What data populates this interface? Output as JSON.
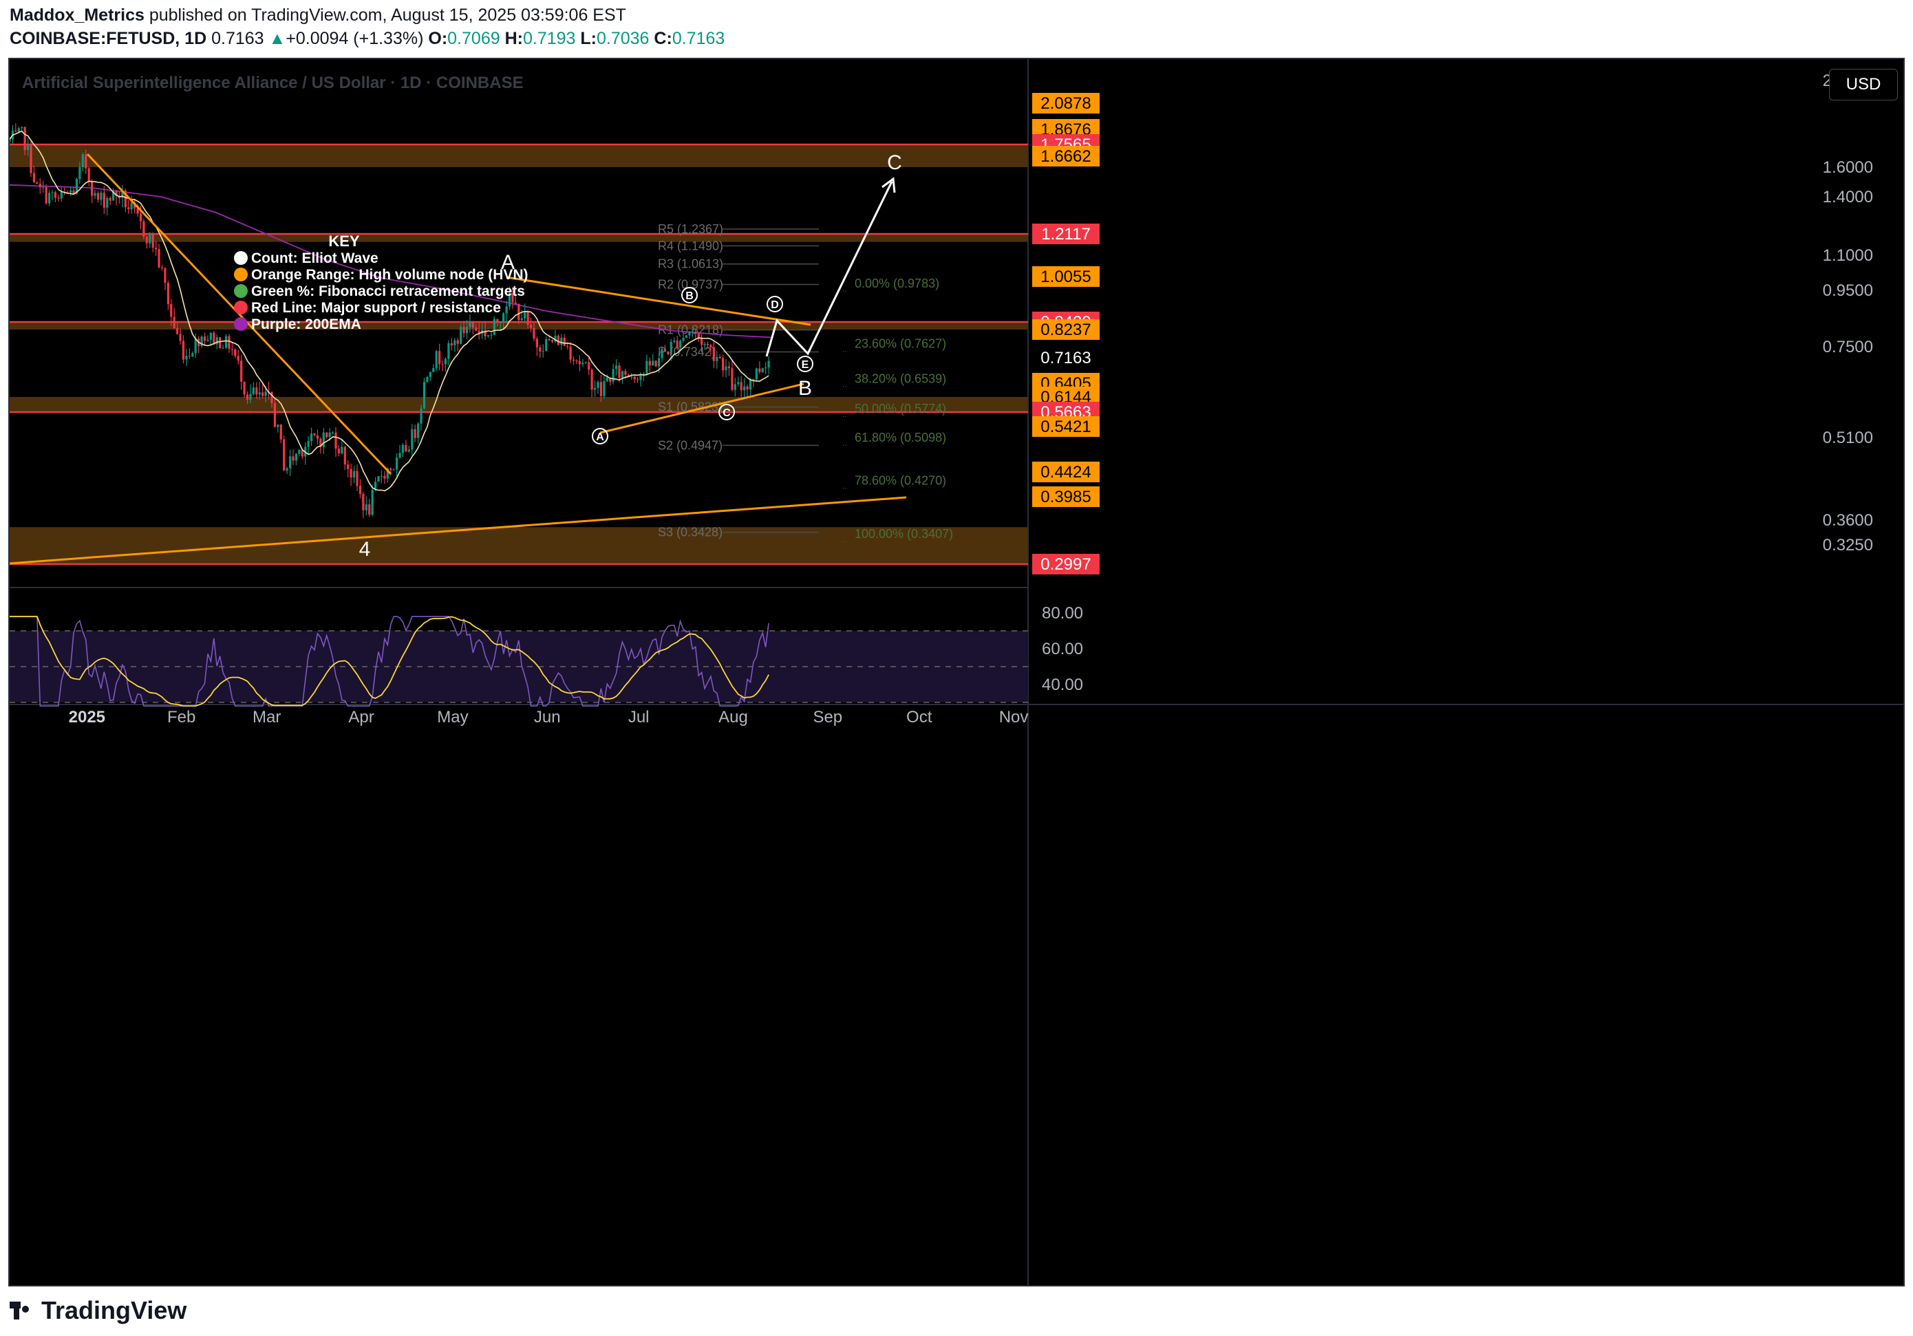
{
  "header": {
    "publisher": "Maddox_Metrics",
    "published_text": "published on TradingView.com, August 15, 2025 03:59:06 EST",
    "symbol": "COINBASE:FETUSD, 1D",
    "last": "0.7163",
    "change": "+0.0094 (+1.33%)",
    "open_label": "O:",
    "open": "0.7069",
    "high_label": "H:",
    "high": "0.7193",
    "low_label": "L:",
    "low": "0.7036",
    "close_label": "C:",
    "close": "0.7163"
  },
  "chart": {
    "watermark": "Artificial Superintelligence Alliance / US Dollar · 1D · COINBASE",
    "currency_button": "USD"
  },
  "legend": {
    "title": "KEY",
    "items": [
      {
        "color": "#ffffff",
        "text": "Count: Elliot Wave"
      },
      {
        "color": "#ff9800",
        "text": "Orange Range: High volume node (HVN)"
      },
      {
        "color": "#4caf50",
        "text": "Green %: Fibonacci retracement targets"
      },
      {
        "color": "#f23645",
        "text": "Red Line: Major support / resistance"
      },
      {
        "color": "#9c27b0",
        "text": "Purple: 200EMA"
      }
    ]
  },
  "price_axis": {
    "ticks": [
      {
        "price": 2.3,
        "label": "2.3000"
      },
      {
        "price": 1.6,
        "label": "1.6000"
      },
      {
        "price": 1.4,
        "label": "1.4000"
      },
      {
        "price": 1.1,
        "label": "1.1000"
      },
      {
        "price": 0.95,
        "label": "0.9500"
      },
      {
        "price": 0.75,
        "label": "0.7500"
      },
      {
        "price": 0.51,
        "label": "0.5100"
      },
      {
        "price": 0.36,
        "label": "0.3600"
      },
      {
        "price": 0.325,
        "label": "0.3250"
      }
    ],
    "badges": [
      {
        "price": 2.0878,
        "label": "2.0878",
        "color": "#ff9800",
        "text_color": "#000000"
      },
      {
        "price": 1.8676,
        "label": "1.8676",
        "color": "#ff9800",
        "text_color": "#000000"
      },
      {
        "price": 1.7565,
        "label": "1.7565",
        "color": "#f23645",
        "text_color": "#ffffff"
      },
      {
        "price": 1.6662,
        "label": "1.6662",
        "color": "#ff9800",
        "text_color": "#000000"
      },
      {
        "price": 1.2117,
        "label": "1.2117",
        "color": "#f23645",
        "text_color": "#ffffff"
      },
      {
        "price": 1.0055,
        "label": "1.0055",
        "color": "#ff9800",
        "text_color": "#000000"
      },
      {
        "price": 0.8429,
        "label": "0.8429",
        "color": "#f23645",
        "text_color": "#ffffff"
      },
      {
        "price": 0.8237,
        "label": "0.8237",
        "color": "#ff9800",
        "text_color": "#000000"
      },
      {
        "price": 0.7163,
        "label": "0.7163",
        "color": "#000000",
        "text_color": "#ffffff"
      },
      {
        "price": 0.6405,
        "label": "0.6405",
        "color": "#ff9800",
        "text_color": "#000000"
      },
      {
        "price": 0.6144,
        "label": "0.6144",
        "color": "#ff9800",
        "text_color": "#000000"
      },
      {
        "price": 0.5663,
        "label": "0.5663",
        "color": "#f23645",
        "text_color": "#ffffff"
      },
      {
        "price": 0.5421,
        "label": "0.5421",
        "color": "#ff9800",
        "text_color": "#000000"
      },
      {
        "price": 0.4424,
        "label": "0.4424",
        "color": "#ff9800",
        "text_color": "#000000"
      },
      {
        "price": 0.3985,
        "label": "0.3985",
        "color": "#ff9800",
        "text_color": "#000000"
      },
      {
        "price": 0.2997,
        "label": "0.2997",
        "color": "#f23645",
        "text_color": "#ffffff"
      }
    ]
  },
  "time_axis": {
    "labels": [
      {
        "text": "2025",
        "bold": true,
        "date": "2025-01-01"
      },
      {
        "text": "Feb",
        "date": "2025-02-01"
      },
      {
        "text": "Mar",
        "date": "2025-03-01"
      },
      {
        "text": "Apr",
        "date": "2025-04-01"
      },
      {
        "text": "May",
        "date": "2025-05-01"
      },
      {
        "text": "Jun",
        "date": "2025-06-01"
      },
      {
        "text": "Jul",
        "date": "2025-07-01"
      },
      {
        "text": "Aug",
        "date": "2025-08-01"
      },
      {
        "text": "Sep",
        "date": "2025-09-01"
      },
      {
        "text": "Oct",
        "date": "2025-10-01"
      },
      {
        "text": "Nov",
        "date": "2025-11-01"
      }
    ]
  },
  "rsi_axis": {
    "ticks": [
      {
        "value": 80,
        "label": "80.00"
      },
      {
        "value": 60,
        "label": "60.00"
      },
      {
        "value": 40,
        "label": "40.00"
      }
    ],
    "bands": [
      70,
      50,
      30
    ]
  },
  "zones": [
    {
      "top": 1.7565,
      "bottom": 1.6
    },
    {
      "top": 1.2117,
      "bottom": 1.17
    },
    {
      "top": 0.8429,
      "bottom": 0.8237
    },
    {
      "top": 0.6144,
      "bottom": 0.5663
    },
    {
      "top": 0.35,
      "bottom": 0.2997
    }
  ],
  "red_lines": [
    1.7565,
    1.2117,
    0.8429,
    0.5663,
    0.2997
  ],
  "pivots": [
    {
      "label": "R5 (1.2367)",
      "price": 1.2367
    },
    {
      "label": "R4 (1.1490)",
      "price": 1.149
    },
    {
      "label": "R3 (1.0613)",
      "price": 1.0613
    },
    {
      "label": "R2 (0.9737)",
      "price": 0.9737
    },
    {
      "label": "R1 (0.8218)",
      "price": 0.8218
    },
    {
      "label": "P (0.7342)",
      "price": 0.7342
    },
    {
      "label": "S1 (0.5823)",
      "price": 0.5823
    },
    {
      "label": "S2 (0.4947)",
      "price": 0.4947
    },
    {
      "label": "S3 (0.3428)",
      "price": 0.3428
    }
  ],
  "fib_levels": [
    {
      "label": "0.00% (0.9783)",
      "price": 0.9783
    },
    {
      "label": "23.60% (0.7627)",
      "price": 0.7627
    },
    {
      "label": "38.20% (0.6539)",
      "price": 0.6539
    },
    {
      "label": "50.00% (0.5774)",
      "price": 0.5774
    },
    {
      "label": "61.80% (0.5098)",
      "price": 0.5098
    },
    {
      "label": "78.60% (0.4270)",
      "price": 0.427
    },
    {
      "label": "100.00% (0.3407)",
      "price": 0.3407
    }
  ],
  "wave_labels": {
    "big_4": "4",
    "big_A": "A",
    "big_B": "B",
    "big_C": "C",
    "sub_A": "A",
    "sub_B": "B",
    "sub_C": "C",
    "sub_D": "D",
    "sub_E": "E"
  },
  "colors": {
    "up": "#089981",
    "down": "#f23645",
    "orange": "#ff9800",
    "red_line": "#f23645",
    "ema200": "#9c27b0",
    "ma": "#f5e6a8",
    "rsi": "#7e57c2",
    "rsi_ma": "#fdd835",
    "fib_text": "#4c6e3c",
    "pivot_text": "#6b6b6b"
  },
  "footer": {
    "brand": "TradingView"
  }
}
